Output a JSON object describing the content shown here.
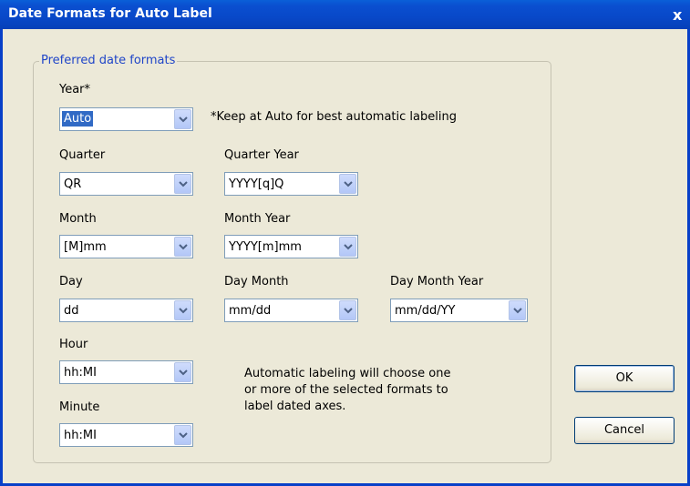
{
  "window": {
    "title": "Date Formats for Auto Label",
    "close_label": "x"
  },
  "group": {
    "title": "Preferred date formats"
  },
  "fields": {
    "year": {
      "label": "Year*",
      "value": "Auto"
    },
    "year_note": "*Keep at Auto for best automatic labeling",
    "quarter": {
      "label": "Quarter",
      "value": "QR"
    },
    "quarter_year": {
      "label": "Quarter Year",
      "value": "YYYY[q]Q"
    },
    "month": {
      "label": "Month",
      "value": "[M]mm"
    },
    "month_year": {
      "label": "Month Year",
      "value": "YYYY[m]mm"
    },
    "day": {
      "label": "Day",
      "value": "dd"
    },
    "day_month": {
      "label": "Day Month",
      "value": "mm/dd"
    },
    "day_month_year": {
      "label": "Day Month Year",
      "value": "mm/dd/YY"
    },
    "hour": {
      "label": "Hour",
      "value": "hh:MI"
    },
    "minute": {
      "label": "Minute",
      "value": "hh:MI"
    }
  },
  "info": {
    "line1": "Automatic labeling will choose one",
    "line2": "or more of the selected formats to",
    "line3": "label dated axes."
  },
  "buttons": {
    "ok": "OK",
    "cancel": "Cancel"
  },
  "icons": {
    "close": "close-icon",
    "dropdown": "chevron-down-icon"
  },
  "colors": {
    "titlebar": "#0a4fd0",
    "dialog_bg": "#ece9d8",
    "legend": "#1f45c8",
    "selection": "#316ac5"
  }
}
